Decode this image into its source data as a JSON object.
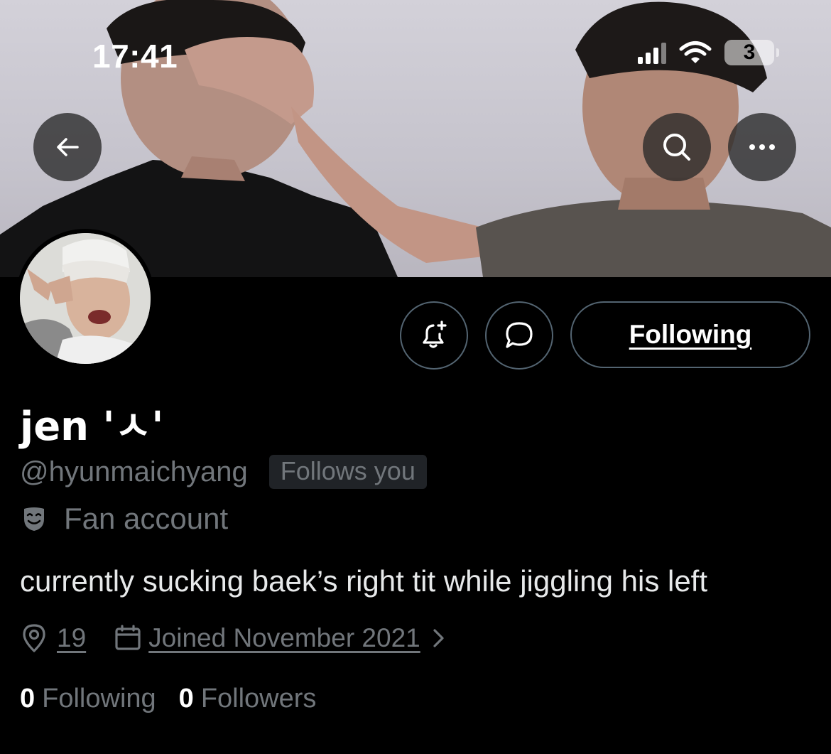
{
  "status_bar": {
    "time": "17:41",
    "battery_level": "3"
  },
  "header": {
    "back_icon": "arrow-left-icon",
    "search_icon": "search-icon",
    "more_icon": "more-horizontal-icon"
  },
  "profile": {
    "display_name": "jen 'ㅅ'",
    "handle": "@hyunmaichyang",
    "follows_you_badge": "Follows you",
    "category_icon": "theater-mask-icon",
    "category": "Fan account",
    "bio": "currently sucking baek’s right tit while jiggling his left",
    "location": "19",
    "joined": "Joined November 2021",
    "following_count": "0",
    "following_label": "Following",
    "followers_count": "0",
    "followers_label": "Followers"
  },
  "actions": {
    "notify_icon": "bell-plus-icon",
    "message_icon": "message-icon",
    "follow_button_label": "Following"
  },
  "colors": {
    "background": "#000000",
    "primary_text": "#e7e9ea",
    "secondary_text": "#71767b",
    "border": "#536471",
    "badge_bg": "#202327"
  }
}
